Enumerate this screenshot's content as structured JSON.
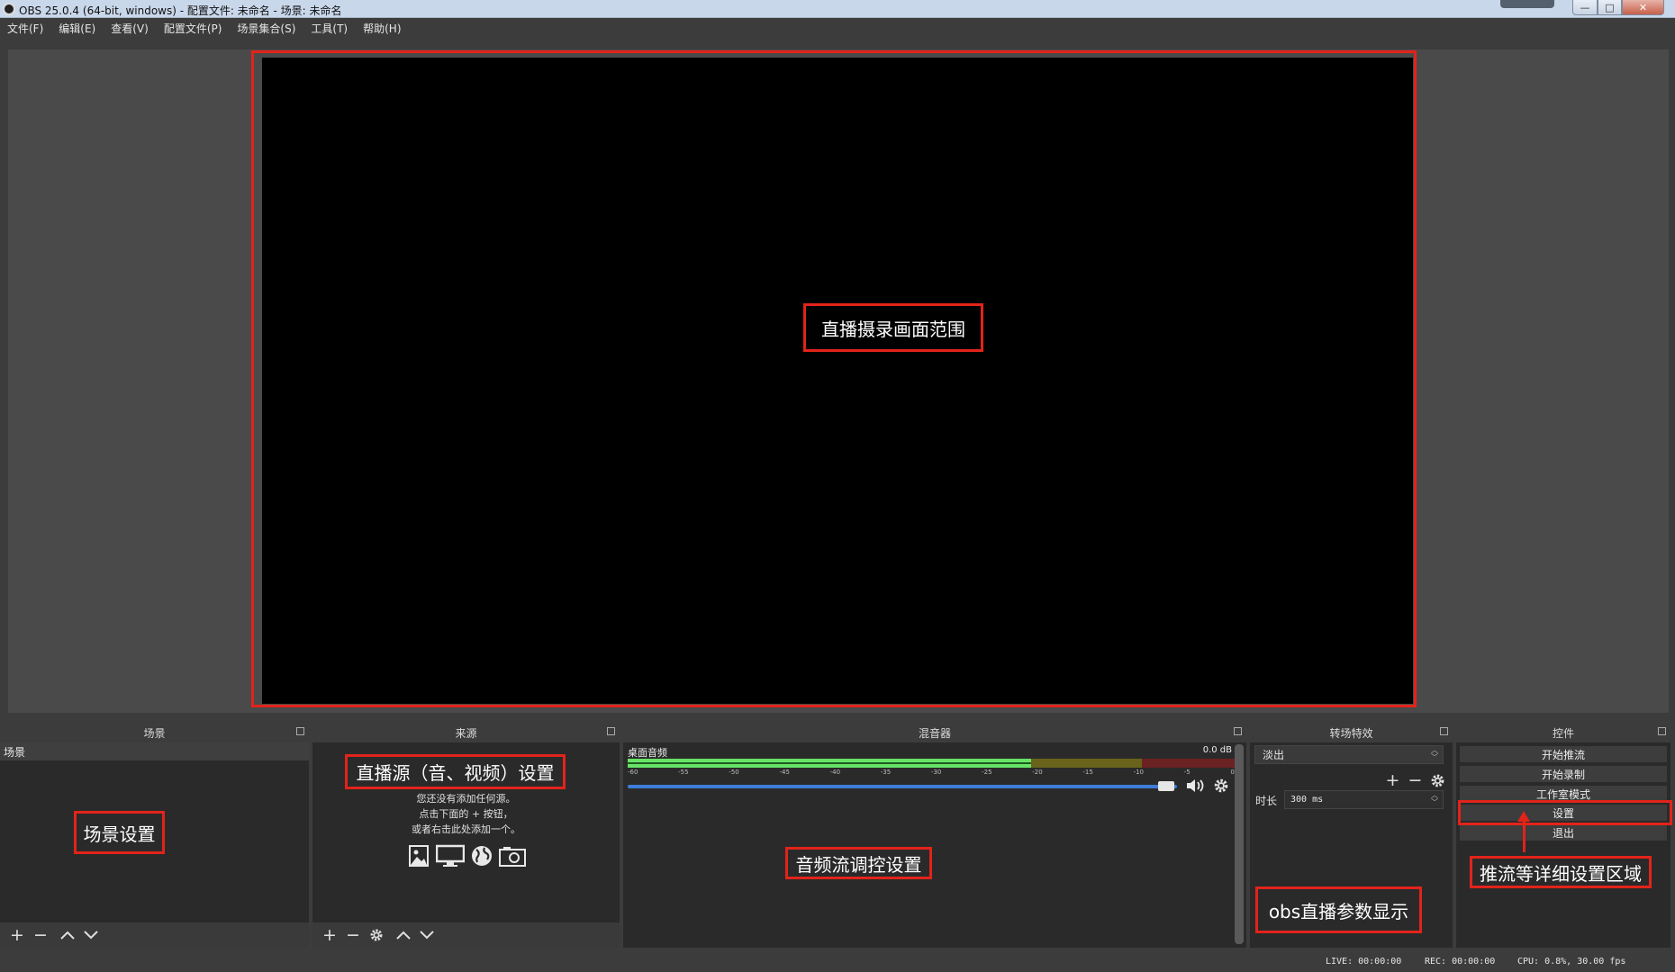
{
  "window": {
    "title": "OBS 25.0.4 (64-bit, windows) - 配置文件: 未命名 - 场景: 未命名",
    "min_glyph": "—",
    "max_glyph": "□",
    "close_glyph": "✕"
  },
  "menu": [
    "文件(F)",
    "编辑(E)",
    "查看(V)",
    "配置文件(P)",
    "场景集合(S)",
    "工具(T)",
    "帮助(H)"
  ],
  "annotations": {
    "preview": "直播摄录画面范围",
    "scenes": "场景设置",
    "sources": "直播源（音、视频）设置",
    "mixer": "音频流调控设置",
    "stats": "obs直播参数显示",
    "controls": "推流等详细设置区域"
  },
  "scenes_dock": {
    "title": "场景",
    "items": [
      "场景"
    ]
  },
  "sources_dock": {
    "title": "来源",
    "hint_lines": [
      "您还没有添加任何源。",
      "点击下面的 + 按钮，",
      "或者右击此处添加一个。"
    ]
  },
  "mixer_dock": {
    "title": "混音器",
    "channel_name": "桌面音频",
    "level": "0.0 dB",
    "ticks": [
      "-60",
      "-55",
      "-50",
      "-45",
      "-40",
      "-35",
      "-30",
      "-25",
      "-20",
      "-15",
      "-10",
      "-5",
      "0"
    ],
    "volume_fraction": 0.98
  },
  "transitions_dock": {
    "title": "转场特效",
    "selected": "淡出",
    "duration_label": "时长",
    "duration_value": "300 ms"
  },
  "controls_dock": {
    "title": "控件",
    "buttons": [
      "开始推流",
      "开始录制",
      "工作室模式",
      "设置",
      "退出"
    ]
  },
  "status": {
    "live": "LIVE: 00:00:00",
    "rec": "REC: 00:00:00",
    "cpu": "CPU: 0.8%, 30.00 fps"
  },
  "colors": {
    "annotation_red": "#e2231a",
    "volume_blue": "#3d7dd8",
    "meter_green": "#67e367"
  }
}
